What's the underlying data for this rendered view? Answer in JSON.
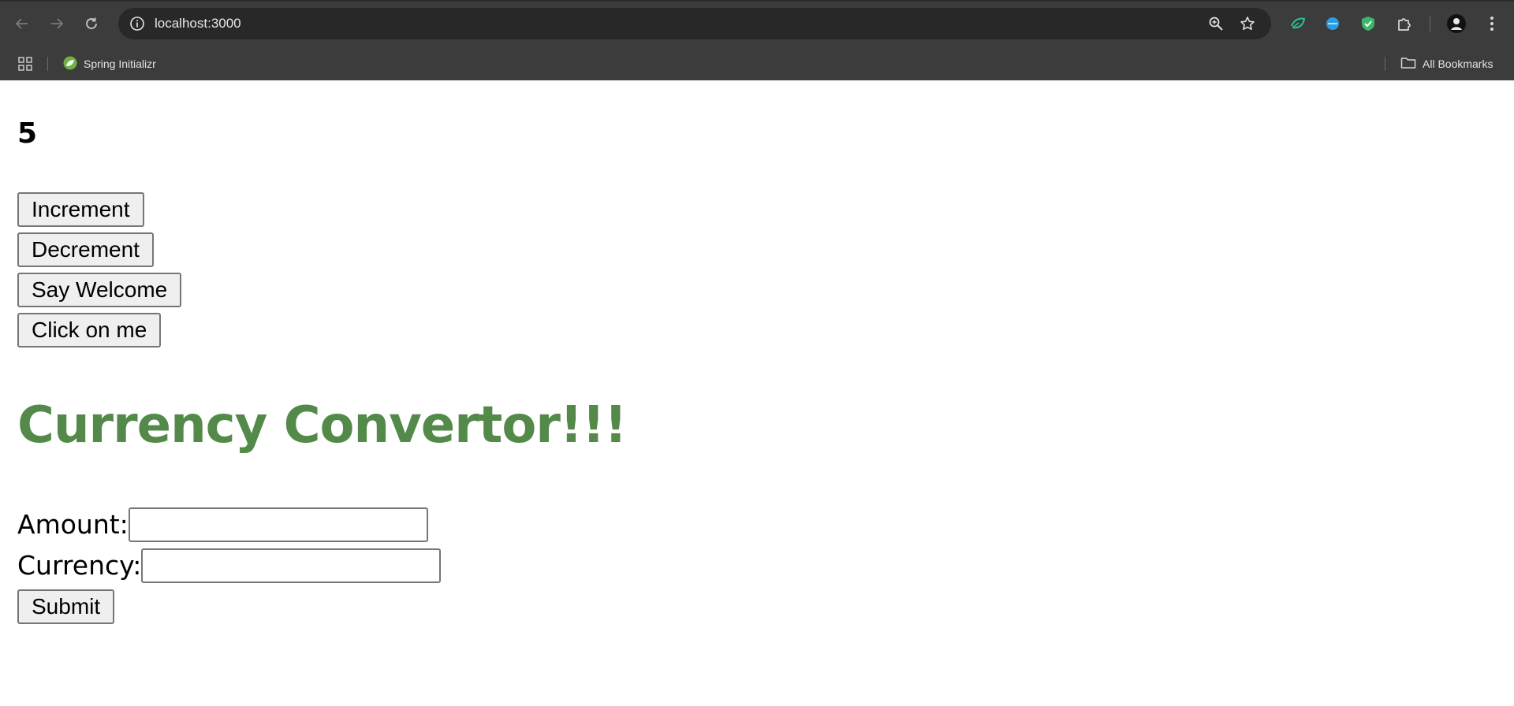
{
  "browser": {
    "url": "localhost:3000",
    "nav": {
      "back_icon": "arrow-left-icon",
      "forward_icon": "arrow-right-icon",
      "reload_icon": "reload-icon"
    },
    "omnibox_icons": [
      "site-info-icon",
      "zoom-icon",
      "star-icon"
    ],
    "extensions": [
      "leaf-extension-icon",
      "globe-extension-icon",
      "shield-check-extension-icon",
      "puzzle-extensions-icon"
    ],
    "profile_icon": "avatar",
    "menu_icon": "kebab-menu-icon"
  },
  "bookmarks_bar": {
    "apps_icon": "apps-grid-icon",
    "items": [
      {
        "label": "Spring Initializr",
        "icon": "spring-leaf-icon",
        "icon_color": "#6db33f"
      }
    ],
    "all_bookmarks_label": "All Bookmarks",
    "all_bookmarks_icon": "folder-icon"
  },
  "app": {
    "counter_value": "5",
    "buttons": [
      {
        "label": "Increment"
      },
      {
        "label": "Decrement"
      },
      {
        "label": "Say Welcome"
      },
      {
        "label": "Click on me"
      }
    ],
    "currency": {
      "title": "Currency Convertor!!!",
      "title_color": "#538a4a",
      "amount_label": "Amount:",
      "amount_value": "",
      "currency_label": "Currency:",
      "currency_value": "",
      "submit_label": "Submit"
    }
  }
}
